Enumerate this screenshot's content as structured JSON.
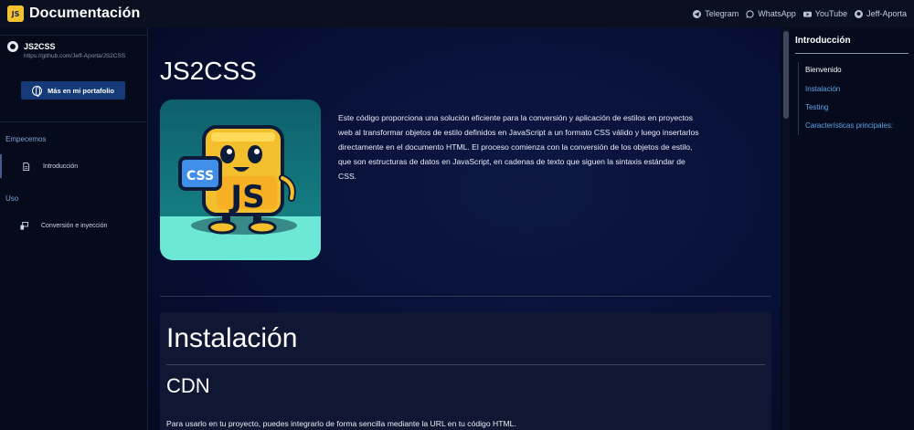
{
  "header": {
    "title": "Documentación",
    "links": [
      {
        "label": "Telegram",
        "icon": "telegram-icon"
      },
      {
        "label": "WhatsApp",
        "icon": "whatsapp-icon"
      },
      {
        "label": "YouTube",
        "icon": "youtube-icon"
      },
      {
        "label": "Jeff-Aporta",
        "icon": "github-icon"
      }
    ]
  },
  "sidebar": {
    "repo_name": "JS2CSS",
    "repo_url": "https://github.com/Jeff-Aporta/JS2CSS",
    "portfolio_button": "Más en mi portafolio",
    "sections": [
      {
        "title": "Empecemos",
        "items": [
          {
            "label": "Introducción",
            "icon": "document-icon"
          }
        ]
      },
      {
        "title": "Uso",
        "items": [
          {
            "label": "Conversión e inyección",
            "icon": "convert-icon"
          }
        ]
      }
    ]
  },
  "main": {
    "title": "JS2CSS",
    "hero_badge_css": "CSS",
    "hero_badge_js": "JS",
    "description": "Este código proporciona una solución eficiente para la conversión y aplicación de estilos en proyectos web al transformar objetos de estilo definidos en JavaScript a un formato CSS válido y luego insertarlos directamente en el documento HTML. El proceso comienza con la conversión de los objetos de estilo, que son estructuras de datos en JavaScript, en cadenas de texto que siguen la sintaxis estándar de CSS.",
    "install_title": "Instalación",
    "cdn_title": "CDN",
    "install_text": "Para usarlo en tu proyecto, puedes integrarlo de forma sencilla mediante la URL en tu código HTML."
  },
  "toc": {
    "title": "Introducción",
    "items": [
      "Bienvenido",
      "Instalación",
      "Testing",
      "Características principales:"
    ]
  },
  "colors": {
    "background": "#050a1c",
    "accent_link": "#60a6e8",
    "button": "#163a78",
    "hero": "#0f6670"
  }
}
